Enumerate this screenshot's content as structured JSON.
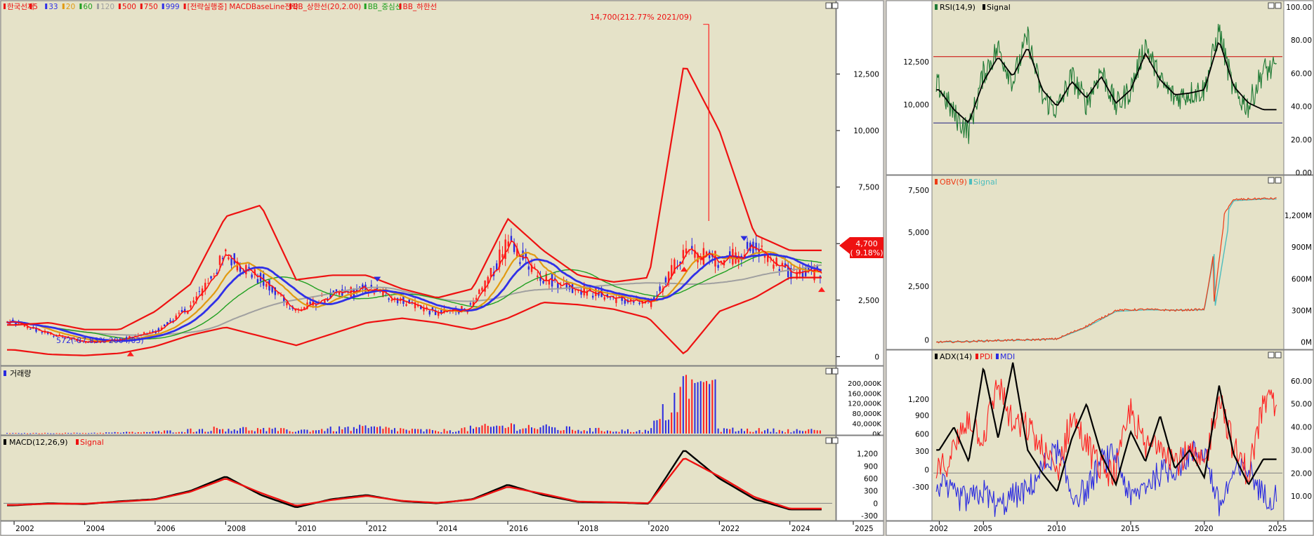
{
  "colors": {
    "plot_bg": "#e5e2c8",
    "axis_bg": "#ffffff",
    "up": "#ff1e1e",
    "down": "#2a2ae0",
    "ma5": "#ff1010",
    "ma33": "#3030e8",
    "ma20": "#e29a10",
    "ma60": "#20a020",
    "ma120": "#a0a0a0",
    "bb": "#ee1111",
    "rsi": "#1f7a35",
    "signal": "#000000",
    "obv": "#ee3b16",
    "obv_signal": "#4dbdbd"
  },
  "main": {
    "legend": [
      {
        "text": "한국선재",
        "color": "#ee1111"
      },
      {
        "text": "5",
        "color": "#ee1111"
      },
      {
        "text": "33",
        "color": "#3030e8"
      },
      {
        "text": "20",
        "color": "#e29a10"
      },
      {
        "text": "60",
        "color": "#20a020"
      },
      {
        "text": "120",
        "color": "#a0a0a0"
      },
      {
        "text": "500",
        "color": "#ee1111"
      },
      {
        "text": "750",
        "color": "#ee1111"
      },
      {
        "text": "999",
        "color": "#3030e8"
      },
      {
        "text": "[전략실행중] MACDBaseLine전략",
        "color": "#ee1111"
      },
      {
        "text": "BB_상한선(20,2.00)",
        "color": "#ee1111"
      },
      {
        "text": "BB_중심선",
        "color": "#20a020"
      },
      {
        "text": "BB_하한선",
        "color": "#ee1111"
      }
    ],
    "y_ticks": [
      "12,500",
      "10,000",
      "7,500",
      "5,000",
      "2,500",
      "0"
    ],
    "high_label": "14,700(212.77% 2021/09)",
    "low_label": "572(-87.83% 2004/03)",
    "price_box": [
      "4,700",
      "( 9.18%)"
    ]
  },
  "volume": {
    "title": "거래량",
    "y_ticks": [
      "200,000K",
      "160,000K",
      "120,000K",
      "80,000K",
      "40,000K",
      "0K"
    ]
  },
  "macd": {
    "title": "MACD(12,26,9)",
    "signal_label": "Signal",
    "y_ticks": [
      "1,200",
      "900",
      "600",
      "300",
      "0",
      "-300"
    ]
  },
  "rsi": {
    "title": "RSI(14,9)",
    "signal_label": "Signal",
    "y_ticks": [
      "100.00",
      "80.00",
      "60.00",
      "40.00",
      "20.00",
      "0.00"
    ]
  },
  "obv": {
    "title": "OBV(9)",
    "signal_label": "Signal",
    "y_ticks": [
      "1,200M",
      "900M",
      "600M",
      "300M",
      "0M"
    ]
  },
  "adx": {
    "title": "ADX(14)",
    "pdi_label": "PDI",
    "mdi_label": "MDI",
    "y_ticks": [
      "60.00",
      "50.00",
      "40.00",
      "30.00",
      "20.00",
      "10.00"
    ]
  },
  "x_axis_left": [
    "2002",
    "2004",
    "2006",
    "2008",
    "2010",
    "2012",
    "2014",
    "2016",
    "2018",
    "2020",
    "2022",
    "2024",
    "2025"
  ],
  "x_axis_right": [
    "2002",
    "2005",
    "2010",
    "2015",
    "2020",
    "2025"
  ],
  "chart_data": [
    {
      "type": "line",
      "title": "한국선재",
      "x": [
        2002,
        2003,
        2004,
        2005,
        2006,
        2007,
        2008,
        2009,
        2010,
        2011,
        2012,
        2013,
        2014,
        2015,
        2016,
        2017,
        2018,
        2019,
        2020,
        2021,
        2022,
        2023,
        2024
      ],
      "series": [
        {
          "name": "한국선재",
          "values": [
            1500,
            1000,
            650,
            750,
            1100,
            2200,
            4500,
            3400,
            2000,
            2700,
            3000,
            2500,
            1900,
            2200,
            5000,
            3500,
            3000,
            2600,
            2300,
            4600,
            4300,
            4800,
            3700
          ]
        },
        {
          "name": "BB_상한선(20,2.00)",
          "values": [
            1400,
            1500,
            1200,
            1200,
            2000,
            3200,
            6200,
            6700,
            3400,
            3600,
            3600,
            3000,
            2600,
            3000,
            6100,
            4700,
            3600,
            3300,
            3500,
            13000,
            10000,
            5400,
            4700
          ]
        },
        {
          "name": "BB_하한선",
          "values": [
            300,
            100,
            50,
            150,
            450,
            950,
            1300,
            900,
            500,
            1000,
            1500,
            1700,
            1500,
            1200,
            1700,
            2400,
            2300,
            2100,
            1700,
            100,
            2000,
            2600,
            3500
          ]
        }
      ],
      "annotations": [
        "14,700(212.77% 2021/09)",
        "572(-87.83% 2004/03)"
      ],
      "ylim": [
        -300,
        15000
      ]
    },
    {
      "type": "bar",
      "title": "거래량",
      "x": [
        2002,
        2004,
        2006,
        2008,
        2010,
        2012,
        2014,
        2016,
        2018,
        2020,
        2021,
        2022,
        2024
      ],
      "values": [
        2000,
        3000,
        8000,
        25000,
        15000,
        28000,
        12000,
        38000,
        20000,
        12000,
        218000,
        20000,
        15000
      ],
      "ylim": [
        0,
        230000
      ]
    },
    {
      "type": "line",
      "title": "MACD(12,26,9)",
      "x": [
        2002,
        2003,
        2004,
        2005,
        2006,
        2007,
        2008,
        2009,
        2010,
        2011,
        2012,
        2013,
        2014,
        2015,
        2016,
        2017,
        2018,
        2019,
        2020,
        2021,
        2022,
        2023,
        2024
      ],
      "series": [
        {
          "name": "MACD(12,26,9)",
          "values": [
            -50,
            0,
            -20,
            50,
            100,
            300,
            650,
            200,
            -100,
            100,
            200,
            50,
            0,
            100,
            450,
            200,
            30,
            20,
            -10,
            1300,
            600,
            100,
            -150
          ]
        },
        {
          "name": "Signal",
          "values": [
            -40,
            -10,
            -10,
            40,
            90,
            280,
            600,
            250,
            -60,
            80,
            180,
            60,
            10,
            90,
            400,
            230,
            40,
            25,
            0,
            1100,
            650,
            150,
            -130
          ]
        }
      ],
      "ylim": [
        -350,
        1450
      ]
    },
    {
      "type": "line",
      "title": "RSI(14,9)",
      "x": [
        2002,
        2003,
        2004,
        2005,
        2006,
        2007,
        2008,
        2009,
        2010,
        2011,
        2012,
        2013,
        2014,
        2015,
        2016,
        2017,
        2018,
        2019,
        2020,
        2021,
        2022,
        2023,
        2024
      ],
      "series": [
        {
          "name": "RSI(14,9)",
          "values": [
            52,
            35,
            25,
            60,
            75,
            55,
            82,
            45,
            38,
            58,
            42,
            62,
            40,
            50,
            78,
            55,
            45,
            48,
            50,
            86,
            48,
            40,
            62
          ]
        },
        {
          "name": "Signal",
          "values": [
            50,
            38,
            30,
            55,
            70,
            58,
            76,
            50,
            40,
            55,
            45,
            58,
            42,
            50,
            72,
            56,
            47,
            48,
            50,
            80,
            52,
            42,
            38
          ]
        }
      ],
      "ylim": [
        0,
        100
      ]
    },
    {
      "type": "line",
      "title": "OBV(9)",
      "x": [
        2002,
        2004,
        2006,
        2008,
        2010,
        2012,
        2014,
        2016,
        2018,
        2020,
        2021,
        2022,
        2024
      ],
      "series": [
        {
          "name": "OBV(9)",
          "values": [
            0,
            5,
            15,
            20,
            30,
            150,
            300,
            310,
            300,
            310,
            1150,
            1350,
            1360
          ]
        },
        {
          "name": "Signal",
          "values": [
            0,
            5,
            14,
            19,
            29,
            140,
            290,
            305,
            302,
            305,
            1100,
            1340,
            1355
          ]
        }
      ],
      "ylim": [
        -50,
        1500
      ]
    },
    {
      "type": "line",
      "title": "ADX(14)",
      "x": [
        2002,
        2003,
        2004,
        2005,
        2006,
        2007,
        2008,
        2009,
        2010,
        2011,
        2012,
        2013,
        2014,
        2015,
        2016,
        2017,
        2018,
        2019,
        2020,
        2021,
        2022,
        2023,
        2024
      ],
      "series": [
        {
          "name": "ADX(14)",
          "values": [
            30,
            40,
            25,
            66,
            35,
            68,
            30,
            20,
            12,
            35,
            50,
            28,
            15,
            38,
            25,
            45,
            22,
            30,
            18,
            58,
            28,
            15,
            26
          ]
        },
        {
          "name": "PDI",
          "values": [
            20,
            30,
            45,
            35,
            60,
            40,
            40,
            30,
            20,
            45,
            32,
            22,
            20,
            48,
            30,
            35,
            25,
            28,
            22,
            55,
            30,
            20,
            50
          ]
        },
        {
          "name": "MDI",
          "values": [
            15,
            10,
            8,
            12,
            5,
            10,
            12,
            22,
            30,
            10,
            12,
            25,
            28,
            8,
            15,
            20,
            22,
            28,
            30,
            5,
            20,
            22,
            10
          ]
        }
      ],
      "ylim": [
        0,
        70
      ]
    }
  ]
}
